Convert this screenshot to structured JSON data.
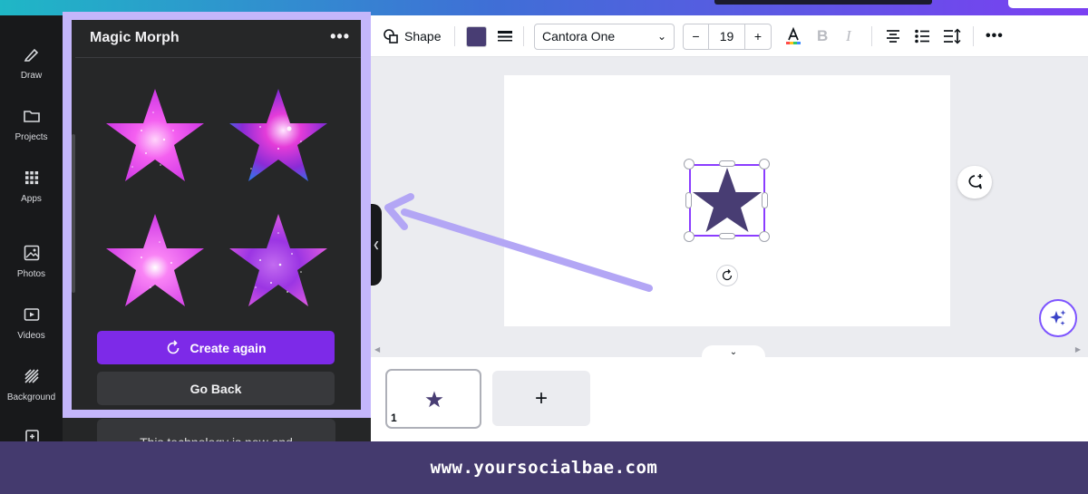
{
  "rail": {
    "items": [
      {
        "label": "Draw",
        "icon": "pen-icon"
      },
      {
        "label": "Projects",
        "icon": "folder-icon"
      },
      {
        "label": "Apps",
        "icon": "apps-grid-icon"
      },
      {
        "label": "Photos",
        "icon": "image-icon"
      },
      {
        "label": "Videos",
        "icon": "play-icon"
      },
      {
        "label": "Background",
        "icon": "hatch-icon"
      }
    ]
  },
  "panel": {
    "title": "Magic Morph",
    "menu_label": "•••",
    "results": [
      "galaxy-star-1",
      "galaxy-star-2",
      "galaxy-star-3",
      "galaxy-star-4"
    ],
    "create_again_label": "Create again",
    "go_back_label": "Go Back",
    "behind_text": "This technology is new and"
  },
  "toolbar": {
    "shape_label": "Shape",
    "fill_color": "#483d73",
    "font_name": "Cantora One",
    "font_size": "19",
    "minus_label": "−",
    "plus_label": "+",
    "bold_label": "B",
    "italic_label": "I",
    "more_label": "•••"
  },
  "canvas": {
    "star_color": "#483d73",
    "selection_color": "#8b3dff"
  },
  "pages": {
    "page_number": "1",
    "add_label": "+"
  },
  "colors": {
    "accent_purple": "#7d2ae8",
    "highlight_border": "#c4b6fb",
    "arrow": "#b3a6f5"
  },
  "footer": {
    "url": "www.yoursocialbae.com"
  }
}
